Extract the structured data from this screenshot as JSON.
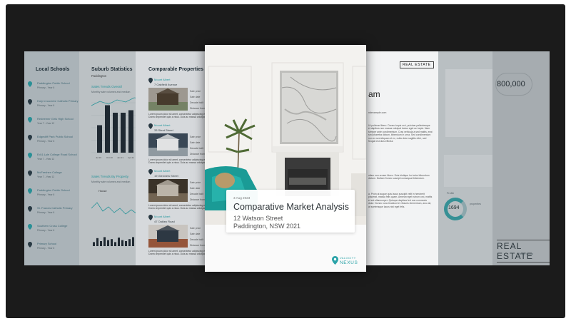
{
  "schools": {
    "title": "Local Schools",
    "items": [
      {
        "name": "Paddington Public School",
        "grade": "Primary - Year 6"
      },
      {
        "name": "Holy Innocents' Catholic Primary",
        "grade": "Primary - Year 6"
      },
      {
        "name": "Redeemer Girls High School",
        "grade": "Year 7 - Year 12"
      },
      {
        "name": "Edgecliff Park Public School",
        "grade": "Primary - Year 6"
      },
      {
        "name": "Ed & Lyle College Road School",
        "grade": "Year 7 - Year 12"
      },
      {
        "name": "McFreshen College",
        "grade": "Year 7 - Year 12"
      },
      {
        "name": "Paddington Public School",
        "grade": "Primary - Year 6"
      },
      {
        "name": "St. Francis Catholic Primary",
        "grade": "Primary - Year 6"
      },
      {
        "name": "Southern Cross College",
        "grade": "Primary - Year 6"
      },
      {
        "name": "Primary School",
        "grade": "Primary - Year 6"
      }
    ]
  },
  "stats": {
    "title": "Suburb Statistics",
    "suburb": "Paddington",
    "trends_label": "Sales Trends Overall",
    "trends_sub": "Monthly sale volumes and median",
    "trends_by_property": "Sales Trends By Property",
    "trends_by_sub": "Monthly sale volumes and median",
    "house_label": "House",
    "bars": [
      0.55,
      0.95,
      0.8,
      0.8,
      0.85,
      0.65
    ],
    "small_bars": [
      0.4,
      0.8,
      0.5,
      0.9,
      0.6,
      0.7,
      0.4,
      0.85,
      0.6,
      0.5,
      0.7,
      0.9,
      0.55,
      0.8
    ],
    "axis_labels": [
      "Jul 20",
      "Oct 20",
      "Jan 21",
      "Apr 21",
      "Jul 21"
    ]
  },
  "comps": {
    "title": "Comparable Properties S",
    "stats": [
      "Sale price",
      "Sale date",
      "Decade built",
      "Distance from"
    ],
    "para": "Lorem ipsum dolor sit amet, consectetur adipiscing elit. Donec imperdiet quis a risus. Duis ac massa volutpat",
    "items": [
      {
        "suburb": "Mount Albert",
        "street": "7 Oakfield Avenue"
      },
      {
        "suburb": "Mount Albert",
        "street": "33 Stent Street"
      },
      {
        "suburb": "Mount Albert",
        "street": "19 Glenview Street"
      },
      {
        "suburb": "Mount Albert",
        "street": "47 Oakley Road"
      }
    ]
  },
  "article": {
    "brand": "REAL ESTATE",
    "heading": "am",
    "email": "ndexample.com",
    "para1": "Ut pulvinar libero. Donec turpis orci, pulvinar pellentesque et dapibus non massa volutpat luctus eget ac turpis. Nam semper ante condimentum. Cras vehicula a sed mattis, erat sed pharetra dictum, bibendum in urna. Sed condimentum non ex sed aliquam et ex, nulla dolor sagittis nibh, sed feugiat est duis efficitur.",
    "para2": "ullam non ornare libero. Duis tristique lor tortor bibendum dictum. Nullam Donec suscipit consequat bibendum.",
    "para3": "a. Proin at augue quis lacus suscipit velit in hendrerit placerat, massa felis quam. Aenean eget rutrum orci, mattis et est ullamcorper. Quisque dapibus fed non commodo dolor. Donec nunc tincidunt et. Mauris elementum, arcu sit, at scelerisque lacus nisi eget felis."
  },
  "right_panel": {
    "price": "800,000",
    "profile_label": "Profile",
    "profile_value": "1694",
    "profile_unit": "properties",
    "brand": "REAL ESTATE",
    "brand_sub": "Realty Group"
  },
  "cover": {
    "date": "3 Aug 2023",
    "title": "Comparative Market Analysis",
    "address_line1": "12 Watson Street",
    "address_line2": "Paddington, NSW 2021",
    "logo_top": "VALOCITY",
    "logo_bottom": "NEXUS"
  },
  "colors": {
    "accent": "#2aa3a8",
    "stage": "#1b1b1b",
    "bar": "#1f2a33"
  }
}
